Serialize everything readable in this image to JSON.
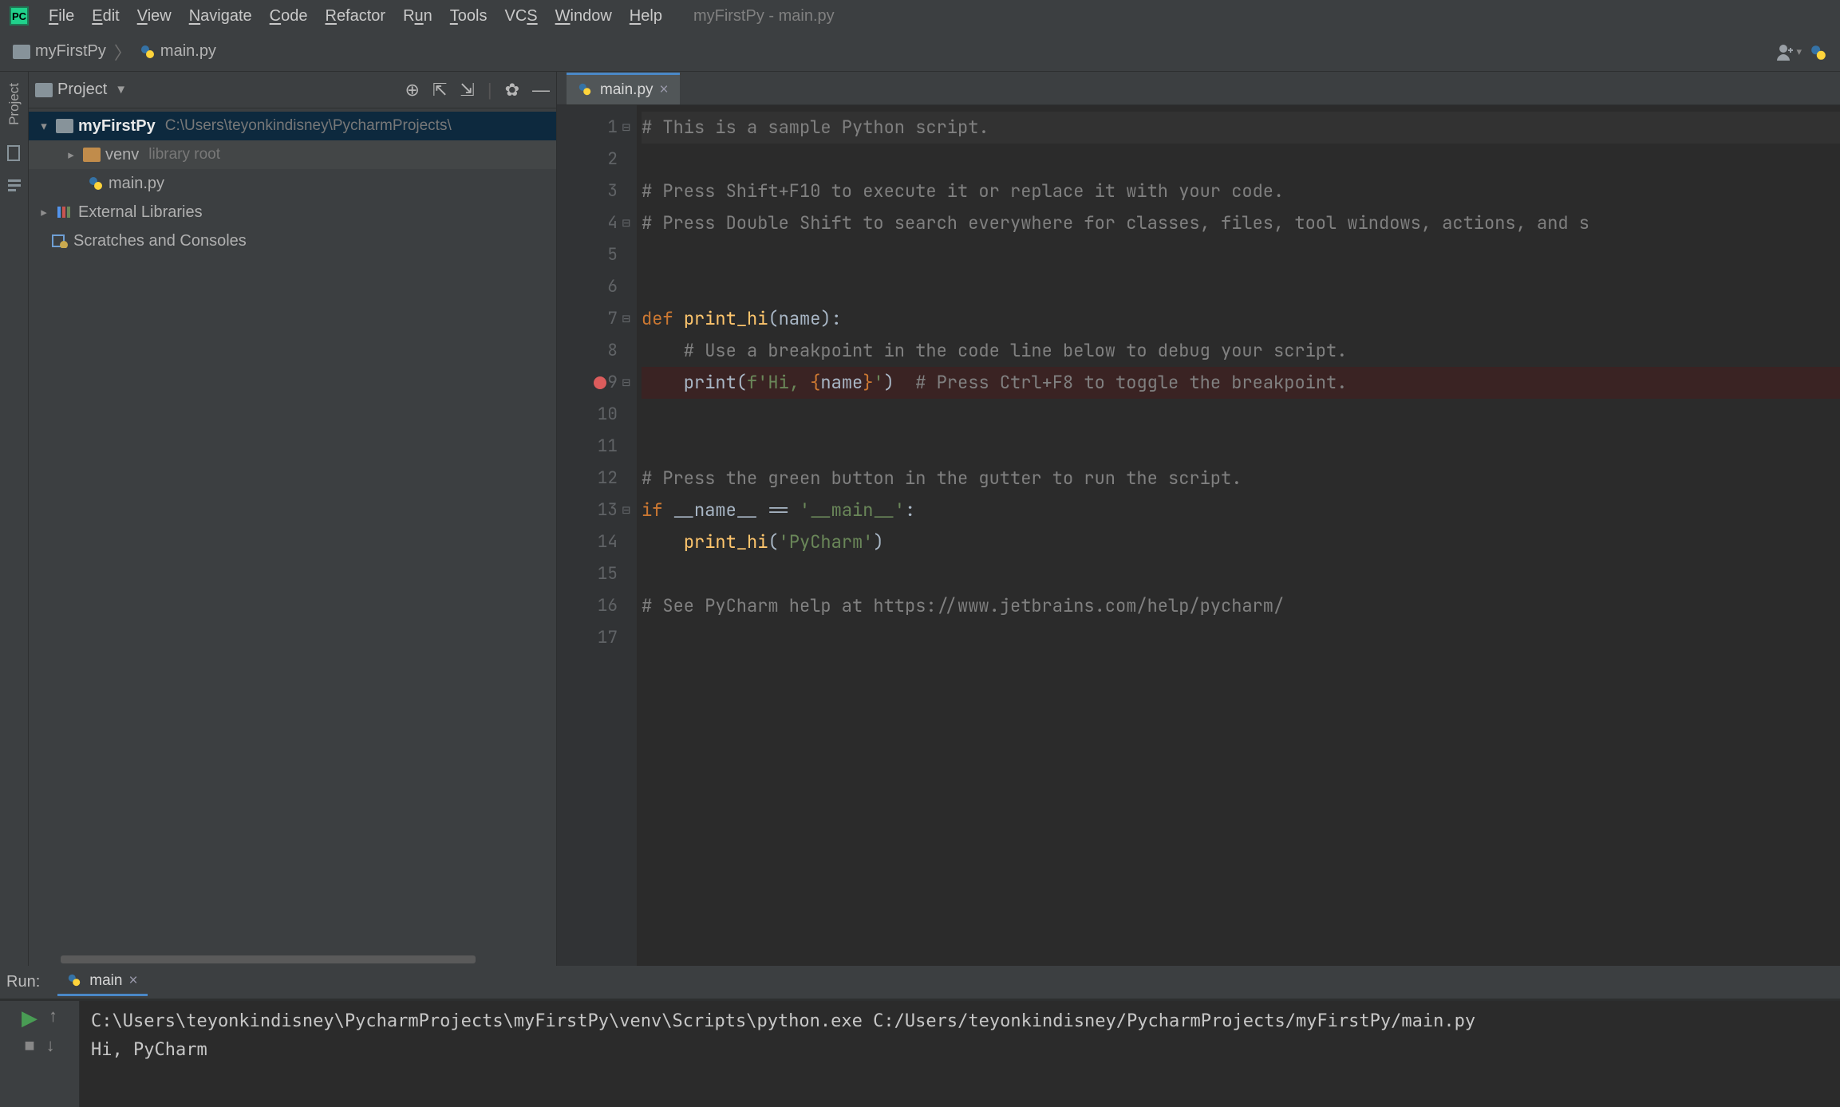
{
  "window": {
    "title": "myFirstPy - main.py"
  },
  "menu": {
    "items": [
      "File",
      "Edit",
      "View",
      "Navigate",
      "Code",
      "Refactor",
      "Run",
      "Tools",
      "VCS",
      "Window",
      "Help"
    ]
  },
  "breadcrumb": {
    "project": "myFirstPy",
    "file": "main.py"
  },
  "project_tool": {
    "label": "Project"
  },
  "project_tree": {
    "title_label": "Project",
    "root": {
      "name": "myFirstPy",
      "path": "C:\\Users\\teyonkindisney\\PycharmProjects\\"
    },
    "nodes": [
      {
        "kind": "venv",
        "name": "venv",
        "suffix": "library root"
      },
      {
        "kind": "pyfile",
        "name": "main.py"
      }
    ],
    "external_label": "External Libraries",
    "scratches_label": "Scratches and Consoles"
  },
  "editor": {
    "tab": {
      "label": "main.py"
    },
    "lines": [
      "# This is a sample Python script.",
      "",
      "# Press Shift+F10 to execute it or replace it with your code.",
      "# Press Double Shift to search everywhere for classes, files, tool windows, actions, and s",
      "",
      "",
      "def print_hi(name):",
      "    # Use a breakpoint in the code line below to debug your script.",
      "    print(f'Hi, {name}')  # Press Ctrl+F8 to toggle the breakpoint.",
      "",
      "",
      "# Press the green button in the gutter to run the script.",
      "if __name__ == '__main__':",
      "    print_hi('PyCharm')",
      "",
      "# See PyCharm help at https://www.jetbrains.com/help/pycharm/",
      ""
    ],
    "breakpoint_line": 9,
    "current_line": 1
  },
  "run": {
    "panel_label": "Run:",
    "tab_label": "main",
    "console_lines": [
      "C:\\Users\\teyonkindisney\\PycharmProjects\\myFirstPy\\venv\\Scripts\\python.exe C:/Users/teyonkindisney/PycharmProjects/myFirstPy/main.py",
      "Hi, PyCharm"
    ]
  }
}
